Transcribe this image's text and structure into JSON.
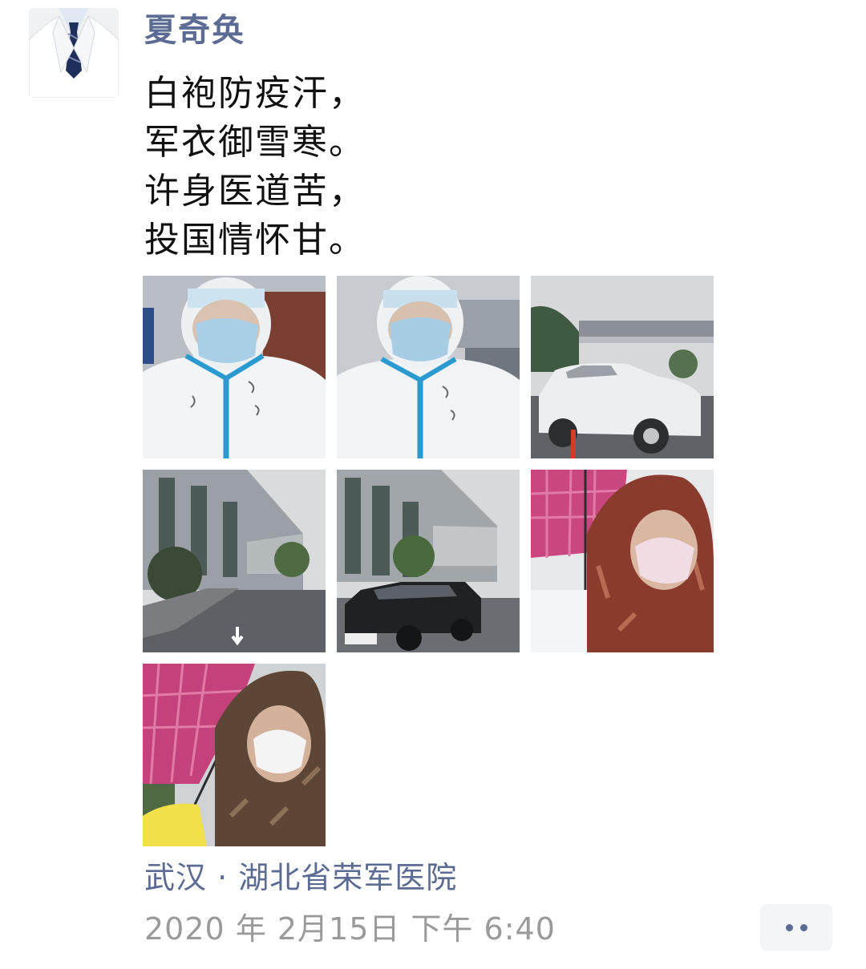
{
  "post": {
    "author": "夏奇奂",
    "poem_lines": [
      "白袍防疫汗，",
      "军衣御雪寒。",
      "许身医道苦，",
      "投国情怀甘。"
    ],
    "location": "武汉 · 湖北省荣军医院",
    "time": "2020 年 2月15日 下午 6:40"
  },
  "photos": [
    {
      "subject": "selfie-protective-suit-1"
    },
    {
      "subject": "selfie-protective-suit-2"
    },
    {
      "subject": "snow-covered-white-suv"
    },
    {
      "subject": "hospital-building-entrance"
    },
    {
      "subject": "black-suv-in-front-of-hospital"
    },
    {
      "subject": "selfie-pink-umbrella-mask"
    },
    {
      "subject": "selfie-umbrella-white-mask"
    }
  ],
  "colors": {
    "name_link": "#5b6b93",
    "timestamp": "#9a9a9a",
    "text": "#111111"
  },
  "icons": {
    "more": "more-dots-icon"
  }
}
